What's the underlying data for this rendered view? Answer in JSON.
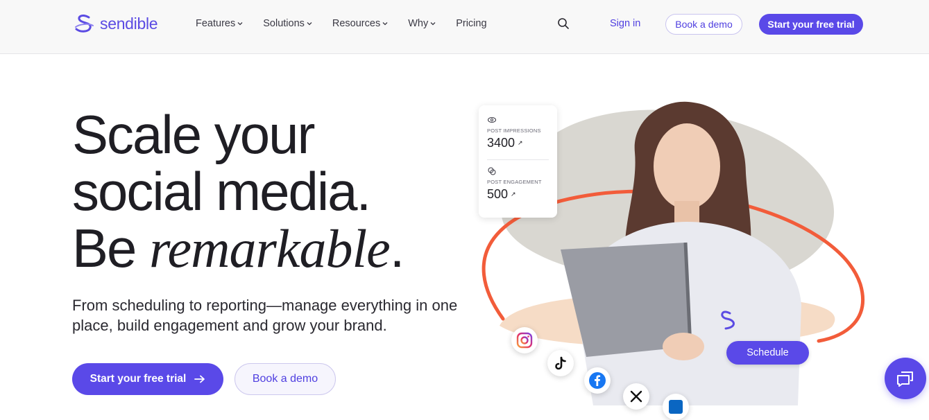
{
  "brand": {
    "name": "sendible",
    "color": "#5a49e8",
    "text_color": "#1f1e24"
  },
  "nav": {
    "items": [
      {
        "label": "Features",
        "has_dropdown": true
      },
      {
        "label": "Solutions",
        "has_dropdown": true
      },
      {
        "label": "Resources",
        "has_dropdown": true
      },
      {
        "label": "Why",
        "has_dropdown": true
      },
      {
        "label": "Pricing",
        "has_dropdown": false
      }
    ],
    "search_icon": "search-icon",
    "signin_label": "Sign in",
    "demo_label": "Book a demo",
    "trial_label": "Start your free trial"
  },
  "hero": {
    "title_line1": "Scale your",
    "title_line2": "social media.",
    "title_line3_prefix": "Be ",
    "title_line3_emphasis": "remarkable",
    "title_line3_suffix": ".",
    "subtitle": "From scheduling to reporting—manage everything in one place, build engagement and grow your brand.",
    "primary_cta": "Start your free trial",
    "primary_cta_icon": "arrow-right-icon",
    "secondary_cta": "Book a demo"
  },
  "stats_card": {
    "impressions_label": "POST IMPRESSIONS",
    "impressions_value": "3400",
    "engagement_label": "POST ENGAGEMENT",
    "engagement_value": "500",
    "trend_icon": "arrow-up-right-icon"
  },
  "schedule_label": "Schedule",
  "social_icons": [
    "instagram-icon",
    "tiktok-icon",
    "facebook-icon",
    "x-icon",
    "linkedin-icon"
  ],
  "accent_colors": {
    "orange_arc": "#f25c3a",
    "gray_blob": "#d8d6d0",
    "peach_blob": "#f6dcc6"
  },
  "chat_icon": "chat-icon"
}
